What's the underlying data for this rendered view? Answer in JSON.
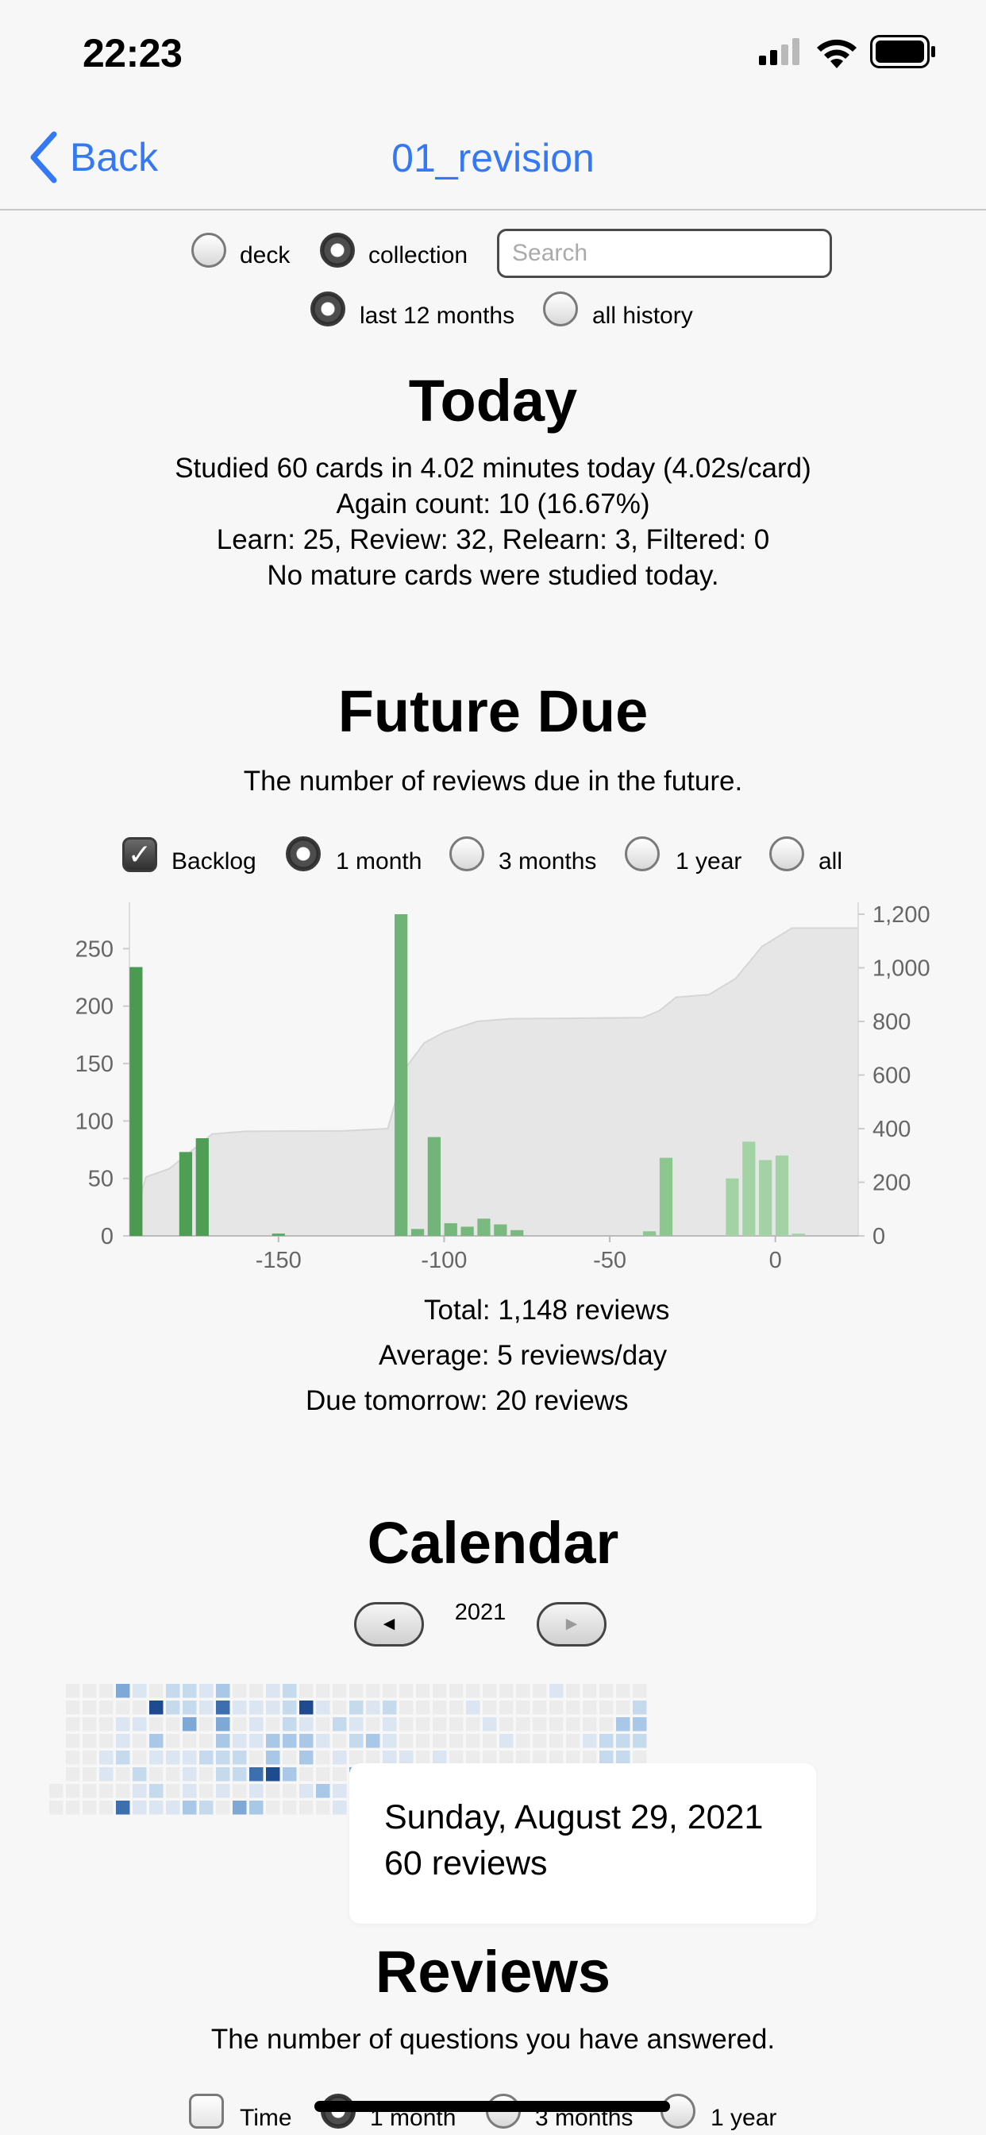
{
  "status_bar": {
    "time": "22:23"
  },
  "nav": {
    "back_label": "Back",
    "title": "01_revision"
  },
  "filters": {
    "scope": [
      {
        "label": "deck",
        "selected": false
      },
      {
        "label": "collection",
        "selected": true
      }
    ],
    "search_placeholder": "Search",
    "period": [
      {
        "label": "last 12 months",
        "selected": true
      },
      {
        "label": "all history",
        "selected": false
      }
    ]
  },
  "today": {
    "heading": "Today",
    "lines": [
      "Studied 60 cards in 4.02 minutes today (4.02s/card)",
      "Again count: 10 (16.67%)",
      "Learn: 25, Review: 32, Relearn: 3, Filtered: 0",
      "No mature cards were studied today."
    ]
  },
  "future_due": {
    "heading": "Future Due",
    "subtitle": "The number of reviews due in the future.",
    "options": [
      {
        "label": "Backlog",
        "kind": "checkbox",
        "checked": true
      },
      {
        "label": "1 month",
        "kind": "radio",
        "checked": true
      },
      {
        "label": "3 months",
        "kind": "radio",
        "checked": false
      },
      {
        "label": "1 year",
        "kind": "radio",
        "checked": false
      },
      {
        "label": "all",
        "kind": "radio",
        "checked": false
      }
    ],
    "stats": {
      "total_label": "Total:",
      "total_value": "1,148 reviews",
      "average_label": "Average:",
      "average_value": "5 reviews/day",
      "tomorrow_label": "Due tomorrow:",
      "tomorrow_value": "20 reviews"
    }
  },
  "chart_data": {
    "type": "bar",
    "title": "",
    "xlabel": "",
    "ylabel": "",
    "xlim": [
      -195,
      25
    ],
    "ylim": [
      0,
      280
    ],
    "y2lim": [
      0,
      1200
    ],
    "x_ticks": [
      -150,
      -100,
      -50,
      0
    ],
    "y_ticks": [
      0,
      50,
      100,
      150,
      200,
      250
    ],
    "y2_ticks": [
      "0",
      "200",
      "400",
      "600",
      "800",
      "1,000",
      "1,200"
    ],
    "grid": false,
    "bars": [
      {
        "x": -193,
        "value": 234,
        "color": "#4a9a52"
      },
      {
        "x": -178,
        "value": 73,
        "color": "#4e9e56"
      },
      {
        "x": -173,
        "value": 85,
        "color": "#4e9e56"
      },
      {
        "x": -150,
        "value": 2,
        "color": "#5ea865"
      },
      {
        "x": -113,
        "value": 280,
        "color": "#6fb376"
      },
      {
        "x": -108,
        "value": 6,
        "color": "#72b479"
      },
      {
        "x": -103,
        "value": 86,
        "color": "#72b479"
      },
      {
        "x": -98,
        "value": 11,
        "color": "#76b77c"
      },
      {
        "x": -93,
        "value": 8,
        "color": "#76b77c"
      },
      {
        "x": -88,
        "value": 15,
        "color": "#7aba80"
      },
      {
        "x": -83,
        "value": 10,
        "color": "#7aba80"
      },
      {
        "x": -78,
        "value": 5,
        "color": "#7aba80"
      },
      {
        "x": -38,
        "value": 4,
        "color": "#8cc790"
      },
      {
        "x": -33,
        "value": 68,
        "color": "#8cc790"
      },
      {
        "x": -13,
        "value": 50,
        "color": "#a3d3a5"
      },
      {
        "x": -8,
        "value": 82,
        "color": "#a3d3a5"
      },
      {
        "x": -3,
        "value": 66,
        "color": "#a3d3a5"
      },
      {
        "x": 2,
        "value": 70,
        "color": "#a3d3a5"
      },
      {
        "x": 7,
        "value": 2,
        "color": "#a3d3a5"
      }
    ],
    "cumulative": [
      [
        -195,
        0
      ],
      [
        -190,
        220
      ],
      [
        -183,
        250
      ],
      [
        -178,
        300
      ],
      [
        -170,
        380
      ],
      [
        -160,
        390
      ],
      [
        -130,
        392
      ],
      [
        -117,
        400
      ],
      [
        -112,
        620
      ],
      [
        -106,
        720
      ],
      [
        -100,
        760
      ],
      [
        -90,
        800
      ],
      [
        -80,
        810
      ],
      [
        -60,
        812
      ],
      [
        -40,
        814
      ],
      [
        -35,
        840
      ],
      [
        -30,
        890
      ],
      [
        -20,
        900
      ],
      [
        -12,
        960
      ],
      [
        -4,
        1080
      ],
      [
        5,
        1148
      ],
      [
        25,
        1148
      ]
    ]
  },
  "calendar": {
    "heading": "Calendar",
    "year": "2021",
    "prev_label": "◄",
    "next_label": "►",
    "tooltip_date": "Sunday, August 29, 2021",
    "tooltip_count": "60 reviews"
  },
  "reviews": {
    "heading": "Reviews",
    "subtitle": "The number of questions you have answered.",
    "options": [
      {
        "label": "Time",
        "kind": "checkbox",
        "checked": false
      },
      {
        "label": "1 month",
        "kind": "radio",
        "checked": true
      },
      {
        "label": "3 months",
        "kind": "radio",
        "checked": false
      },
      {
        "label": "1 year",
        "kind": "radio",
        "checked": false
      }
    ]
  }
}
